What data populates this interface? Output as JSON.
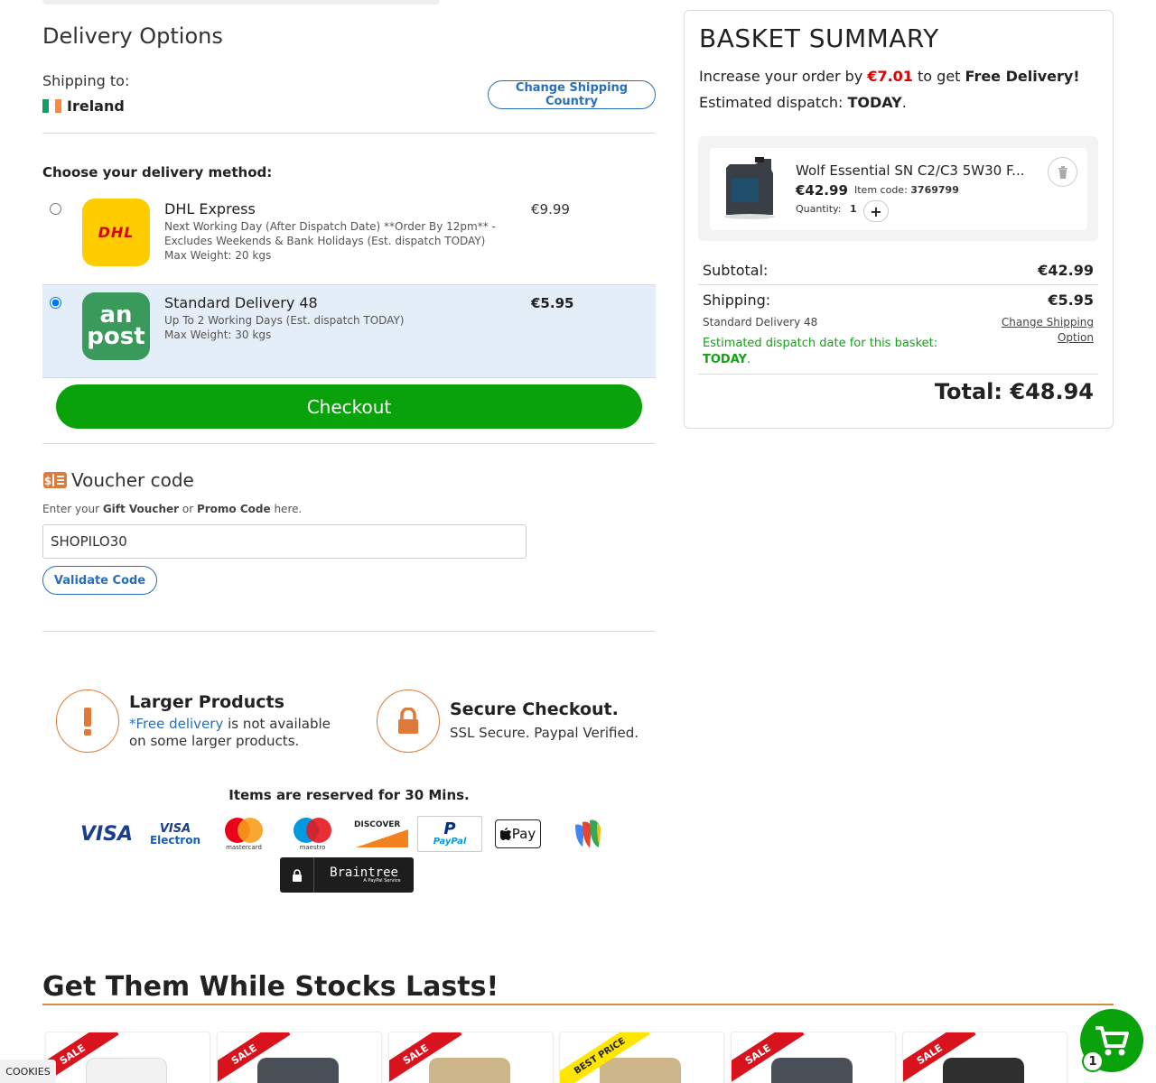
{
  "delivery": {
    "title": "Delivery Options",
    "shipping_to_label": "Shipping to:",
    "country": "Ireland",
    "change_country_button": "Change Shipping Country",
    "choose_label": "Choose your delivery method:",
    "options": [
      {
        "name": "DHL Express",
        "description_line1": "Next Working Day (After Dispatch Date) **Order By 12pm** -",
        "description_line2": "Excludes Weekends & Bank Holidays (Est. dispatch TODAY)",
        "max_weight": "Max Weight: 20 kgs",
        "price": "€9.99",
        "logo_text": "DHL",
        "selected": false
      },
      {
        "name": "Standard Delivery 48",
        "description_line1": "Up To 2 Working Days (Est. dispatch TODAY)",
        "description_line2": "",
        "max_weight": "Max Weight: 30 kgs",
        "price": "€5.95",
        "logo_text_1": "an",
        "logo_text_2": "post",
        "selected": true
      }
    ],
    "checkout_button": "Checkout"
  },
  "voucher": {
    "title": "Voucher code",
    "sub_prefix": "Enter your ",
    "sub_gift": "Gift Voucher",
    "sub_or": " or ",
    "sub_promo": "Promo Code",
    "sub_suffix": " here.",
    "input_value": "SHOPILO30",
    "validate_button": "Validate Code"
  },
  "info": {
    "larger_title": "Larger Products",
    "larger_link": "*Free delivery",
    "larger_text_1": " is not available",
    "larger_text_2": "on some larger products.",
    "secure_title": "Secure Checkout.",
    "secure_text": "SSL Secure. Paypal Verified.",
    "reserved": "Items are reserved for 30 Mins."
  },
  "payments": {
    "visa": "VISA",
    "visa_electron_1": "VISA",
    "visa_electron_2": "Electron",
    "mastercard": "mastercard",
    "maestro": "maestro",
    "discover": "DISCOVER",
    "paypal": "PayPal",
    "applepay": "Pay",
    "braintree": "Braintree",
    "braintree_sub": "A PayPal Service"
  },
  "stocks": {
    "title": "Get Them While Stocks Lasts!",
    "ribbons": [
      "SALE",
      "SALE",
      "SALE",
      "BEST PRICE",
      "SALE",
      "SALE"
    ]
  },
  "cookies_label": "COOKIES",
  "cart_count": "1",
  "basket": {
    "title": "BASKET SUMMARY",
    "increase_prefix": "Increase your order by ",
    "increase_amount": "€7.01",
    "increase_middle": " to get ",
    "increase_bold": "Free Delivery!",
    "dispatch_prefix": "Estimated dispatch: ",
    "dispatch_value": "TODAY",
    "dispatch_suffix": ".",
    "item": {
      "name": "Wolf Essential SN C2/C3 5W30 F...",
      "price": "€42.99",
      "code_label": "Item code: ",
      "code": "3769799",
      "qty_label": "Quantity:",
      "qty": "1",
      "plus": "+"
    },
    "subtotal_label": "Subtotal:",
    "subtotal_value": "€42.99",
    "shipping_label": "Shipping:",
    "shipping_value": "€5.95",
    "shipping_method": "Standard Delivery 48",
    "change_option_1": "Change Shipping",
    "change_option_2": "Option",
    "dispatch_note": "Estimated dispatch date for this basket:",
    "dispatch_note_value": "TODAY",
    "total_label": "Total: ",
    "total_value": "€48.94"
  }
}
